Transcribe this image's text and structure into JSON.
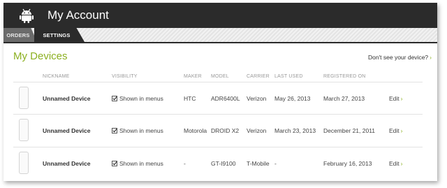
{
  "header": {
    "title": "My Account",
    "logo_icon": "android-robot-icon"
  },
  "tabs": [
    {
      "label": "ORDERS",
      "active": false
    },
    {
      "label": "SETTINGS",
      "active": true
    }
  ],
  "devices": {
    "title": "My Devices",
    "help_link": "Don't see your device?",
    "help_chevron": "›",
    "columns": {
      "nickname": "NICKNAME",
      "visibility": "VISIBILITY",
      "maker": "MAKER",
      "model": "MODEL",
      "carrier": "CARRIER",
      "last_used": "LAST USED",
      "registered_on": "REGISTERED ON"
    },
    "rows": [
      {
        "nickname": "Unnamed Device",
        "visibility": "Shown in menus",
        "visible_checked": true,
        "maker": "HTC",
        "model": "ADR6400L",
        "carrier": "Verizon",
        "last_used": "May 26, 2013",
        "registered_on": "March 27, 2013",
        "edit": "Edit",
        "edit_chevron": "›"
      },
      {
        "nickname": "Unnamed Device",
        "visibility": "Shown in menus",
        "visible_checked": true,
        "maker": "Motorola",
        "model": "DROID X2",
        "carrier": "Verizon",
        "last_used": "March 23, 2013",
        "registered_on": "December 21, 2011",
        "edit": "Edit",
        "edit_chevron": "›"
      },
      {
        "nickname": "Unnamed Device",
        "visibility": "Shown in menus",
        "visible_checked": true,
        "maker": "-",
        "model": "GT-I9100",
        "carrier": "T-Mobile",
        "last_used": "-",
        "registered_on": "February 16, 2013",
        "edit": "Edit",
        "edit_chevron": "›"
      }
    ]
  },
  "colors": {
    "header_bg": "#2b2b2b",
    "accent_green": "#8cb021",
    "tab_inactive": "#6b6b6b"
  }
}
